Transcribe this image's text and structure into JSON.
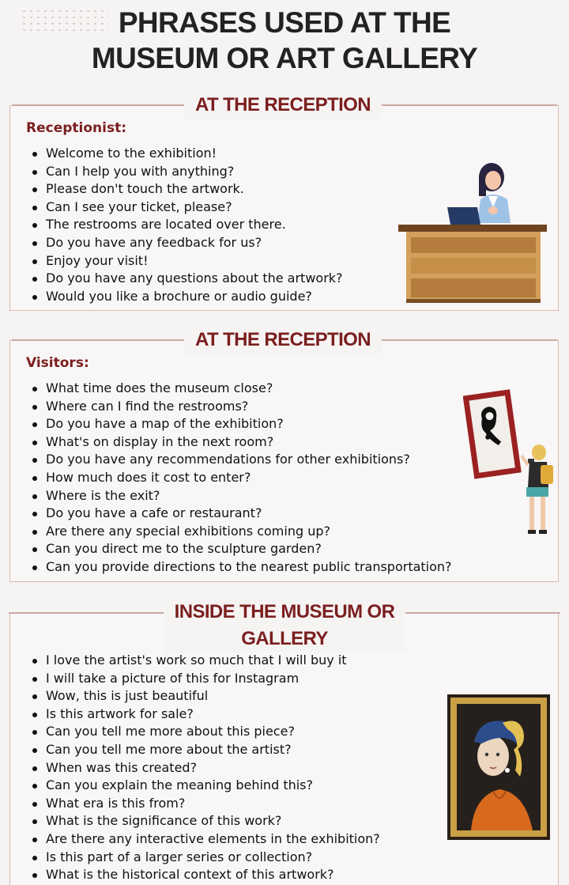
{
  "title": {
    "line1": "PHRASES USED AT THE",
    "line2": "MUSEUM OR ART GALLERY"
  },
  "sections": [
    {
      "heading": "AT THE RECEPTION",
      "role": "Receptionist:",
      "phrases": [
        "Welcome to the exhibition!",
        "Can I help you with anything?",
        "Please don't touch the artwork.",
        "Can I see your ticket, please?",
        "The restrooms are located over there.",
        "Do you have any feedback for us?",
        "Enjoy your visit!",
        "Do you have any questions about the artwork?",
        "Would you like a brochure or audio guide?"
      ]
    },
    {
      "heading": "AT THE RECEPTION",
      "role": "Visitors:",
      "phrases": [
        "What time does the museum close?",
        "Where can I find the restrooms?",
        "Do you have a map of the exhibition?",
        "What's on display in the next room?",
        "Do you have any recommendations for other exhibitions?",
        "How much does it cost to enter?",
        "Where is the exit?",
        "Do you have a cafe or restaurant?",
        "Are there any special exhibitions coming up?",
        "Can you direct me to the sculpture garden?",
        "Can you provide directions to the nearest public transportation?"
      ]
    },
    {
      "heading_line1": "INSIDE THE MUSEUM OR",
      "heading_line2": "GALLERY",
      "phrases": [
        "I love the artist's work so much that I will buy it",
        "I will take a picture of this for Instagram",
        "Wow, this is just beautiful",
        "Is this artwork for sale?",
        "Can you tell me more about this piece?",
        "Can you tell me more about the artist?",
        "When was this created?",
        "Can you explain the meaning behind this?",
        "What era is this from?",
        "What is the significance of this work?",
        "Are there any interactive elements in the exhibition?",
        "Is this part of a larger series or collection?",
        "What is the historical context of this artwork?"
      ]
    }
  ],
  "colors": {
    "accent": "#7b1f1f",
    "border": "#dcb8b0",
    "background": "#f6f3f3"
  },
  "illustrations": [
    "receptionist-at-desk-icon",
    "visitor-photographing-painting-icon",
    "girl-with-pearl-earring-painting-icon"
  ]
}
